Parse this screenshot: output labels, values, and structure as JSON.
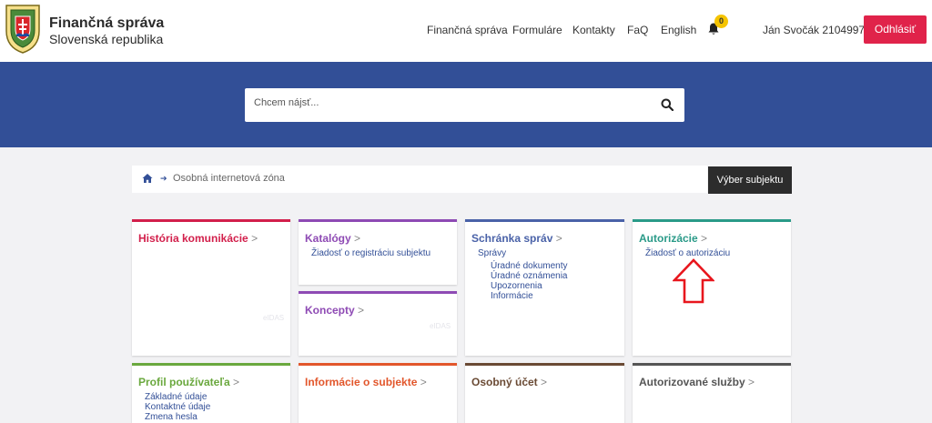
{
  "brand": {
    "title": "Finančná správa",
    "subtitle": "Slovenská republika"
  },
  "nav": {
    "items": [
      "Finančná správa",
      "Formuláre",
      "Kontakty",
      "FaQ",
      "English"
    ]
  },
  "notifications": {
    "count": "0"
  },
  "user": {
    "name": "Ján Svočák 2104997",
    "logout_label": "Odhlásiť"
  },
  "search": {
    "placeholder": "Chcem nájsť..."
  },
  "breadcrumb": {
    "current": "Osobná internetová zóna",
    "select_subject_label": "Výber subjektu"
  },
  "tiles": {
    "historia": {
      "title": "História komunikácie",
      "gt": ">",
      "eidas": "eIDAS"
    },
    "katalogy": {
      "title": "Katalógy",
      "gt": ">",
      "links": [
        "Žiadosť o registráciu subjektu"
      ]
    },
    "koncepty": {
      "title": "Koncepty",
      "gt": ">",
      "eidas": "eIDAS"
    },
    "schranka": {
      "title": "Schránka správ",
      "gt": ">",
      "links": [
        "Správy",
        "Úradné dokumenty",
        "Úradné oznámenia",
        "Upozornenia",
        "Informácie"
      ]
    },
    "autorizacie": {
      "title": "Autorizácie",
      "gt": ">",
      "links": [
        "Žiadosť o autorizáciu"
      ]
    },
    "profil": {
      "title": "Profil používateľa",
      "gt": ">",
      "links": [
        "Základné údaje",
        "Kontaktné údaje",
        "Zmena hesla"
      ]
    },
    "informacie": {
      "title": "Informácie o subjekte",
      "gt": ">"
    },
    "ucet": {
      "title": "Osobný účet",
      "gt": ">"
    },
    "sluzby": {
      "title": "Autorizované služby",
      "gt": ">"
    }
  },
  "colors": {
    "primary": "#324f97",
    "logout": "#e0234a",
    "historia": "#d21f4b",
    "katalogy": "#8e4ab4",
    "schranka": "#4a62a8",
    "autorizacie": "#2a9a88",
    "profil": "#6aa83e",
    "informacie": "#e2562b",
    "ucet": "#6a4a34",
    "sluzby": "#555555"
  }
}
